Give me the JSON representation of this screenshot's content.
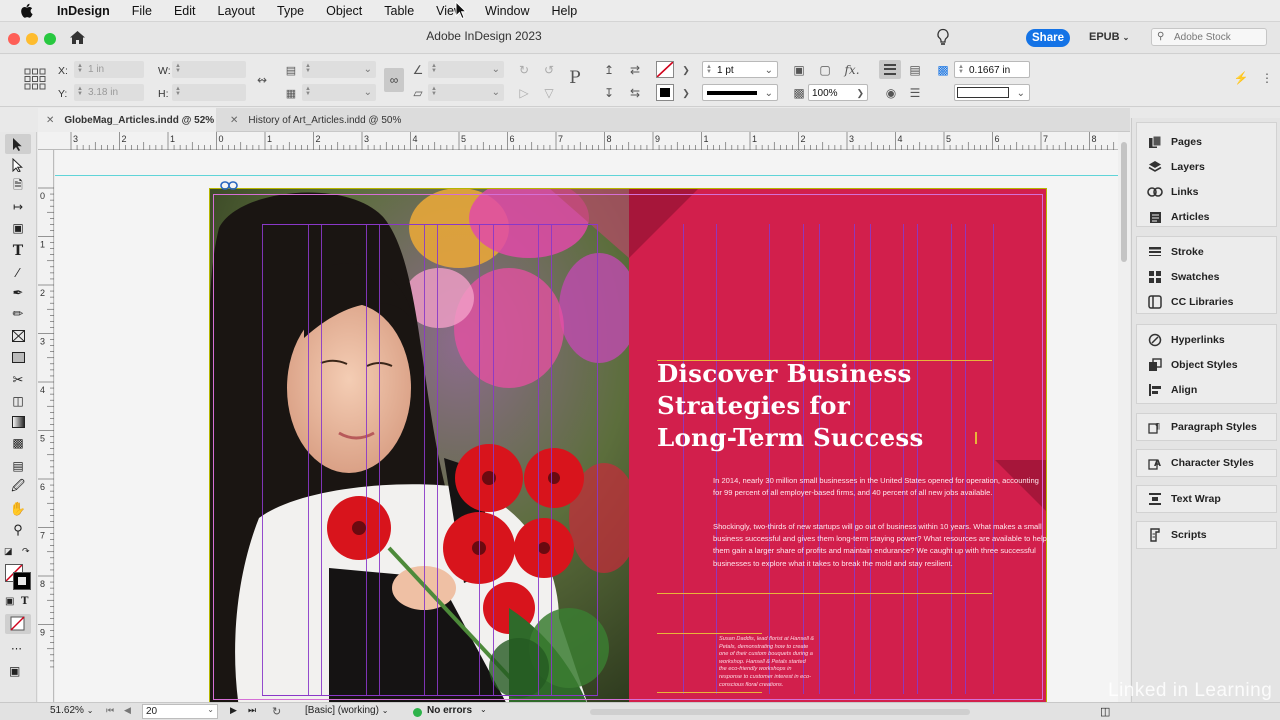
{
  "menubar": {
    "app_name": "InDesign",
    "items": [
      "File",
      "Edit",
      "Layout",
      "Type",
      "Object",
      "Table",
      "View",
      "Window",
      "Help"
    ]
  },
  "titlebar": {
    "title": "Adobe InDesign 2023",
    "share_label": "Share",
    "epub_label": "EPUB",
    "search_placeholder": "Adobe Stock"
  },
  "control_panel": {
    "x_label": "X:",
    "x_value": "1 in",
    "y_label": "Y:",
    "y_value": "3.18 in",
    "w_label": "W:",
    "h_label": "H:",
    "stroke_weight": "1 pt",
    "opacity": "100%",
    "gutter": "0.1667 in"
  },
  "tabs": [
    {
      "label": "GlobeMag_Articles.indd @ 52%",
      "active": true
    },
    {
      "label": "History of Art_Articles.indd @ 50%",
      "active": false
    }
  ],
  "ruler": {
    "top_labels": [
      "3",
      "2",
      "1",
      "0",
      "1",
      "2",
      "3",
      "4",
      "5",
      "6",
      "7",
      "8",
      "9",
      "1",
      "1",
      "2",
      "3",
      "4",
      "5",
      "6",
      "7",
      "8",
      "9"
    ],
    "side_labels": [
      "0",
      "1",
      "2",
      "3",
      "4",
      "5",
      "6",
      "7",
      "8",
      "9"
    ]
  },
  "document": {
    "headline_line1": "Discover Business",
    "headline_line2": "Strategies for",
    "headline_line3": "Long-Term Success",
    "paragraph1": "In 2014, nearly 30 million small businesses in the United States opened for operation, accounting for 99 percent of all employer-based firms, and 40 percent of all new jobs available.",
    "paragraph2": "Shockingly, two-thirds of new startups will go out of business within 10 years. What makes a small business successful and gives them long-term staying power? What resources are available to help them gain a larger share of profits and maintain endurance? We caught up with three successful businesses to explore what it takes to break the mold and stay resilient.",
    "sidebar_text": "Susan Daddis, lead florist at Hansell & Petals, demonstrating how to create one of their custom bouquets during a workshop. Hansell & Petals started the eco-friendly workshops in response to customer interest in eco-conscious floral creations."
  },
  "panels": {
    "group1": [
      "Pages",
      "Layers",
      "Links",
      "Articles"
    ],
    "group2": [
      "Stroke",
      "Swatches",
      "CC Libraries"
    ],
    "group3": [
      "Hyperlinks",
      "Object Styles",
      "Align"
    ],
    "group4": [
      "Paragraph Styles"
    ],
    "group5": [
      "Character Styles"
    ],
    "group6": [
      "Text Wrap"
    ],
    "group7": [
      "Scripts"
    ]
  },
  "status": {
    "zoom": "51.62%",
    "page": "20",
    "style": "[Basic] (working)",
    "preflight": "No errors"
  },
  "watermark": "Linked in Learning",
  "colors": {
    "accent_blue": "#1473e6",
    "page_red": "#d21f4c",
    "guide_purple": "#8a38c8",
    "preflight_green": "#2db34a"
  }
}
